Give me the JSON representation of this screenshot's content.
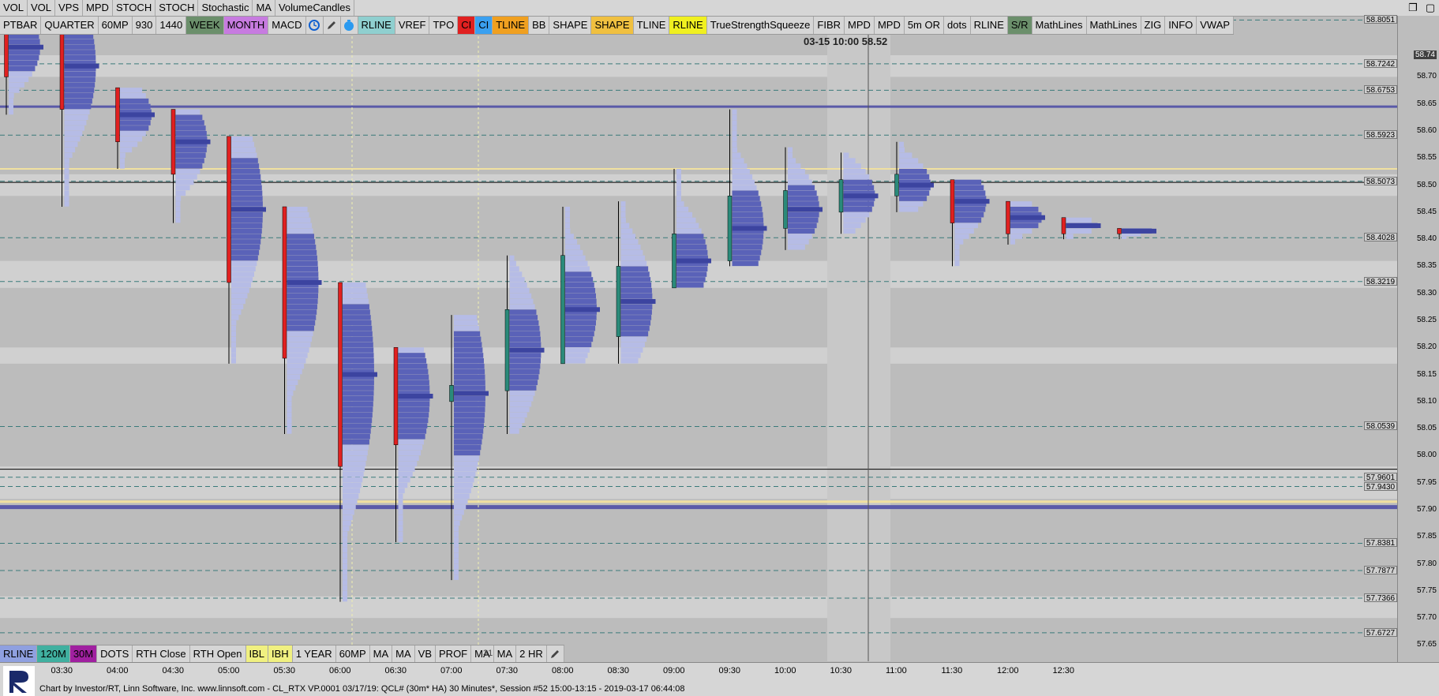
{
  "toolbar_top1": [
    "VOL",
    "VOL",
    "VPS",
    "MPD",
    "STOCH",
    "STOCH",
    "Stochastic",
    "MA",
    "VolumeCandles"
  ],
  "toolbar_top2": [
    {
      "label": "PTBAR",
      "bg": "#d6d6d6"
    },
    {
      "label": "QUARTER",
      "bg": "#d6d6d6"
    },
    {
      "label": "60MP",
      "bg": "#d6d6d6"
    },
    {
      "label": "930",
      "bg": "#d6d6d6"
    },
    {
      "label": "1440",
      "bg": "#d6d6d6"
    },
    {
      "label": "WEEK",
      "bg": "#6b8f6b"
    },
    {
      "label": "MONTH",
      "bg": "#c77be0"
    },
    {
      "label": "MACD",
      "bg": "#d6d6d6"
    },
    {
      "label": "",
      "bg": "#d6d6d6",
      "icon": "clock-icon"
    },
    {
      "label": "",
      "bg": "#d6d6d6",
      "icon": "pencil-icon"
    },
    {
      "label": "",
      "bg": "#d6d6d6",
      "icon": "timer-icon"
    },
    {
      "label": "RLINE",
      "bg": "#8fcfcf"
    },
    {
      "label": "VREF",
      "bg": "#d6d6d6"
    },
    {
      "label": "TPO",
      "bg": "#d6d6d6"
    },
    {
      "label": "CI",
      "bg": "#e02020"
    },
    {
      "label": "CI",
      "bg": "#3aa0f0"
    },
    {
      "label": "TLINE",
      "bg": "#f0a020"
    },
    {
      "label": "BB",
      "bg": "#d6d6d6"
    },
    {
      "label": "SHAPE",
      "bg": "#d6d6d6"
    },
    {
      "label": "SHAPE",
      "bg": "#f0c040"
    },
    {
      "label": "TLINE",
      "bg": "#d6d6d6"
    },
    {
      "label": "RLINE",
      "bg": "#f0f020"
    },
    {
      "label": "TrueStrengthSqueeze",
      "bg": "#d6d6d6"
    },
    {
      "label": "FIBR",
      "bg": "#d6d6d6"
    },
    {
      "label": "MPD",
      "bg": "#d6d6d6"
    },
    {
      "label": "MPD",
      "bg": "#d6d6d6"
    },
    {
      "label": "5m OR",
      "bg": "#d6d6d6"
    },
    {
      "label": "dots",
      "bg": "#d6d6d6"
    },
    {
      "label": "RLINE",
      "bg": "#d6d6d6"
    },
    {
      "label": "S/R",
      "bg": "#6b8f6b"
    },
    {
      "label": "MathLines",
      "bg": "#d6d6d6"
    },
    {
      "label": "MathLines",
      "bg": "#d6d6d6"
    },
    {
      "label": "ZIG",
      "bg": "#d6d6d6"
    },
    {
      "label": "INFO",
      "bg": "#d6d6d6"
    },
    {
      "label": "VWAP",
      "bg": "#d6d6d6"
    }
  ],
  "toolbar_bottom": [
    {
      "label": "RLINE",
      "bg": "#8fa0e0"
    },
    {
      "label": "120M",
      "bg": "#40b0a0"
    },
    {
      "label": "30M",
      "bg": "#a020a0"
    },
    {
      "label": "DOTS",
      "bg": "#d6d6d6"
    },
    {
      "label": "RTH Close",
      "bg": "#d6d6d6"
    },
    {
      "label": "RTH Open",
      "bg": "#d6d6d6"
    },
    {
      "label": "IBL",
      "bg": "#f0f080"
    },
    {
      "label": "IBH",
      "bg": "#f0f080"
    },
    {
      "label": "1 YEAR",
      "bg": "#d6d6d6"
    },
    {
      "label": "60MP",
      "bg": "#d6d6d6"
    },
    {
      "label": "MA",
      "bg": "#d6d6d6"
    },
    {
      "label": "MA",
      "bg": "#d6d6d6"
    },
    {
      "label": "VB",
      "bg": "#d6d6d6"
    },
    {
      "label": "PROF",
      "bg": "#d6d6d6"
    },
    {
      "label": "MA",
      "bg": "#d6d6d6"
    },
    {
      "label": "MA",
      "bg": "#d6d6d6"
    },
    {
      "label": "2 HR",
      "bg": "#d6d6d6"
    },
    {
      "label": "",
      "bg": "#d6d6d6",
      "icon": "pencil-icon"
    }
  ],
  "bottom_counter": "31",
  "window_controls": [
    "❐",
    "▢"
  ],
  "crosshair_tip": {
    "date": "03-15",
    "time": "10:00",
    "price": "58.52"
  },
  "status_text": "Chart by Investor/RT, Linn Software, Inc. www.linnsoft.com - CL_RTX VP.0001   03/17/19: QCL# (30m* HA) 30 Minutes*, Session #52 15:00-13:15 - 2019-03-17 06:44:08",
  "chart_data": {
    "type": "candlestick_profile",
    "x_labels": [
      "03:30",
      "04:00",
      "04:30",
      "05:00",
      "05:30",
      "06:00",
      "06:30",
      "07:00",
      "07:30",
      "08:00",
      "08:30",
      "09:00",
      "09:30",
      "10:00",
      "10:30",
      "11:00",
      "11:30",
      "12:00",
      "12:30"
    ],
    "y_ticks": [
      58.7,
      58.65,
      58.6,
      58.55,
      58.5,
      58.45,
      58.4,
      58.35,
      58.3,
      58.25,
      58.2,
      58.15,
      58.1,
      58.05,
      58.0,
      57.95,
      57.9,
      57.85,
      57.8,
      57.75,
      57.7,
      57.65
    ],
    "ylim": [
      57.62,
      58.81
    ],
    "reference_levels": [
      "58.8051",
      "58.7242",
      "58.6753",
      "58.5923",
      "58.5073",
      "58.4028",
      "58.3219",
      "58.0539",
      "57.9601",
      "57.9430",
      "57.8381",
      "57.7877",
      "57.7366",
      "57.6727"
    ],
    "current_price": "58.74",
    "candles": [
      {
        "x": "03:00",
        "o": 58.81,
        "h": 58.81,
        "l": 58.63,
        "c": 58.7,
        "color": "#e02020"
      },
      {
        "x": "03:30",
        "o": 58.8,
        "h": 58.81,
        "l": 58.46,
        "c": 58.64,
        "color": "#e02020"
      },
      {
        "x": "04:00",
        "o": 58.68,
        "h": 58.68,
        "l": 58.53,
        "c": 58.58,
        "color": "#e02020"
      },
      {
        "x": "04:30",
        "o": 58.64,
        "h": 58.64,
        "l": 58.43,
        "c": 58.52,
        "color": "#e02020"
      },
      {
        "x": "05:00",
        "o": 58.59,
        "h": 58.59,
        "l": 58.17,
        "c": 58.32,
        "color": "#e02020"
      },
      {
        "x": "05:30",
        "o": 58.46,
        "h": 58.46,
        "l": 58.04,
        "c": 58.18,
        "color": "#e02020"
      },
      {
        "x": "06:00",
        "o": 58.32,
        "h": 58.32,
        "l": 57.73,
        "c": 57.98,
        "color": "#e02020"
      },
      {
        "x": "06:30",
        "o": 58.2,
        "h": 58.2,
        "l": 57.84,
        "c": 58.02,
        "color": "#e02020"
      },
      {
        "x": "07:00",
        "o": 58.1,
        "h": 58.26,
        "l": 57.77,
        "c": 58.13,
        "color": "#2a8a7a"
      },
      {
        "x": "07:30",
        "o": 58.12,
        "h": 58.37,
        "l": 58.04,
        "c": 58.27,
        "color": "#2a8a7a"
      },
      {
        "x": "08:00",
        "o": 58.17,
        "h": 58.46,
        "l": 58.17,
        "c": 58.37,
        "color": "#2a8a7a"
      },
      {
        "x": "08:30",
        "o": 58.22,
        "h": 58.47,
        "l": 58.17,
        "c": 58.35,
        "color": "#2a8a7a"
      },
      {
        "x": "09:00",
        "o": 58.31,
        "h": 58.53,
        "l": 58.31,
        "c": 58.41,
        "color": "#2a8a7a"
      },
      {
        "x": "09:30",
        "o": 58.36,
        "h": 58.64,
        "l": 58.35,
        "c": 58.48,
        "color": "#2a8a7a"
      },
      {
        "x": "10:00",
        "o": 58.42,
        "h": 58.57,
        "l": 58.38,
        "c": 58.49,
        "color": "#2a8a7a"
      },
      {
        "x": "10:30",
        "o": 58.45,
        "h": 58.56,
        "l": 58.41,
        "c": 58.51,
        "color": "#2a8a7a"
      },
      {
        "x": "11:00",
        "o": 58.48,
        "h": 58.58,
        "l": 58.45,
        "c": 58.52,
        "color": "#2a8a7a"
      },
      {
        "x": "11:30",
        "o": 58.51,
        "h": 58.51,
        "l": 58.35,
        "c": 58.43,
        "color": "#e02020"
      },
      {
        "x": "12:00",
        "o": 58.47,
        "h": 58.47,
        "l": 58.39,
        "c": 58.41,
        "color": "#e02020"
      },
      {
        "x": "12:30",
        "o": 58.44,
        "h": 58.44,
        "l": 58.4,
        "c": 58.41,
        "color": "#e02020"
      },
      {
        "x": "13:00",
        "o": 58.42,
        "h": 58.42,
        "l": 58.4,
        "c": 58.41,
        "color": "#e02020"
      }
    ]
  }
}
